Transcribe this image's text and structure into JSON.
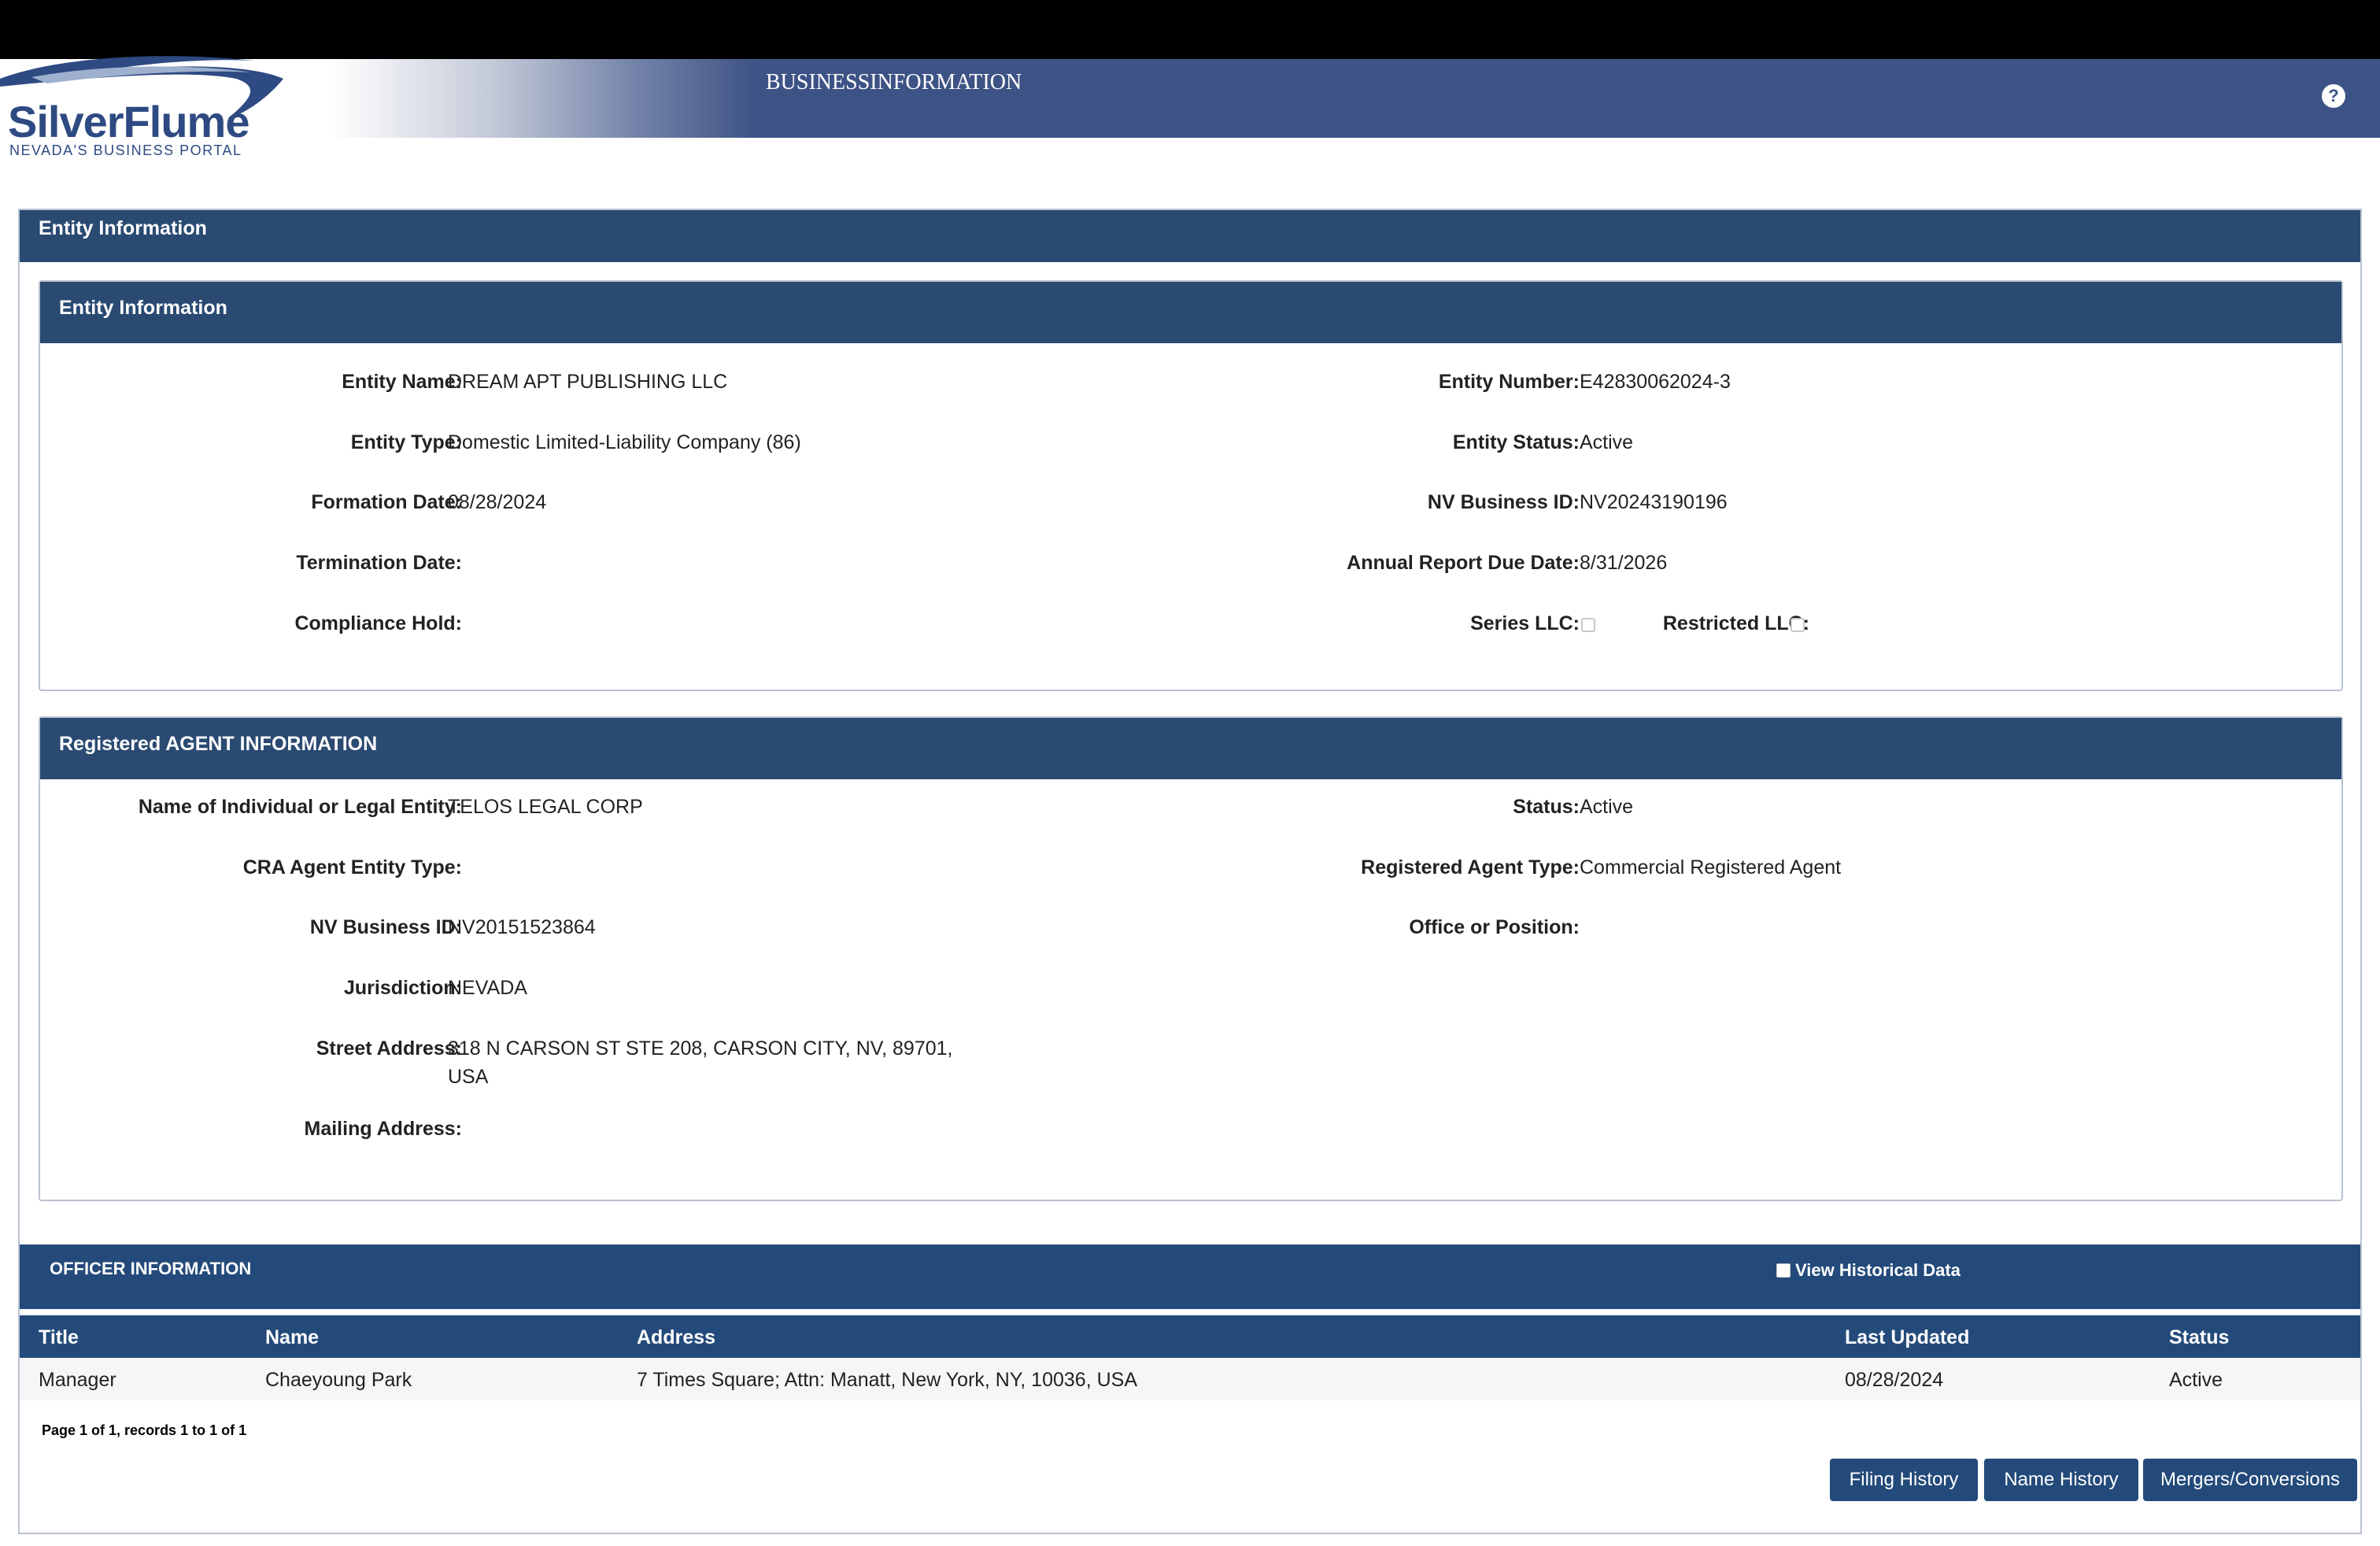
{
  "header": {
    "logo_title": "SilverFlume",
    "logo_subtitle": "NEVADA'S BUSINESS PORTAL",
    "title": "BUSINESSINFORMATION",
    "help_symbol": "?"
  },
  "outer": {
    "title": "Entity Information"
  },
  "entity": {
    "title": "Entity Information",
    "name_label": "Entity Name:",
    "name": "DREAM APT PUBLISHING LLC",
    "type_label": "Entity Type:",
    "type": "Domestic Limited-Liability Company (86)",
    "formation_label": "Formation Date:",
    "formation": "08/28/2024",
    "termination_label": "Termination Date:",
    "compliance_label": "Compliance Hold:",
    "number_label": "Entity Number:",
    "number": "E42830062024-3",
    "status_label": "Entity Status:",
    "status": "Active",
    "nvid_label": "NV Business ID:",
    "nvid": "NV20243190196",
    "annual_label": "Annual Report Due Date:",
    "annual": "8/31/2026",
    "series_label": "Series LLC:",
    "restricted_label": "Restricted LLC:"
  },
  "agent": {
    "title": "Registered AGENT INFORMATION",
    "name_label": "Name of Individual or Legal Entity:",
    "name": "TELOS LEGAL CORP",
    "cra_label": "CRA Agent Entity Type:",
    "nvid_label": "NV Business ID:",
    "nvid": "NV20151523864",
    "jurisdiction_label": "Jurisdiction:",
    "jurisdiction": "NEVADA",
    "street_label": "Street Address:",
    "street_line1": "318 N CARSON ST STE 208, CARSON CITY, NV, 89701,",
    "street_line2": "USA",
    "mailing_label": "Mailing Address:",
    "status_label": "Status:",
    "status": "Active",
    "type_label": "Registered Agent Type:",
    "type": "Commercial Registered Agent",
    "office_label": "Office or Position:"
  },
  "officers": {
    "title": "OFFICER INFORMATION",
    "historical_label": "View Historical Data",
    "columns": [
      "Title",
      "Name",
      "Address",
      "Last Updated",
      "Status"
    ],
    "rows": [
      [
        "Manager",
        "Chaeyoung Park",
        "7 Times Square; Attn: Manatt, New York, NY, 10036, USA",
        "08/28/2024",
        "Active"
      ]
    ],
    "pager": "Page 1 of 1, records 1 to 1 of 1"
  },
  "buttons": {
    "filing_history": "Filing History",
    "name_history": "Name History",
    "mergers": "Mergers/Conversions"
  }
}
